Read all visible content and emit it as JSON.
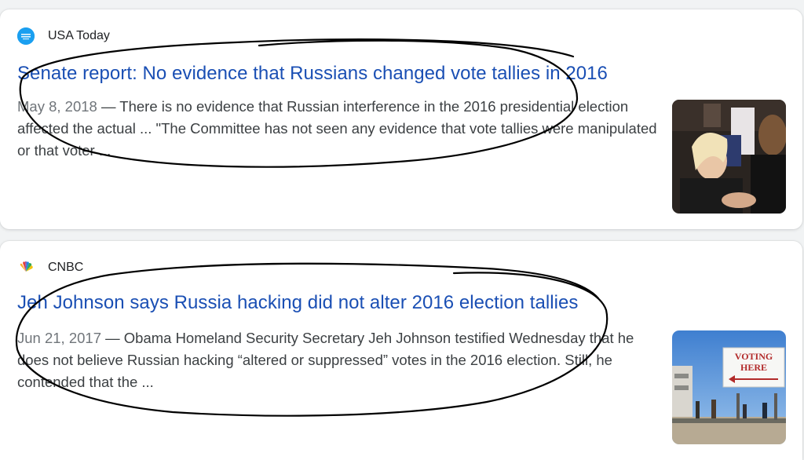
{
  "results": [
    {
      "source": "USA Today",
      "source_logo_icon": "usa-today-logo-icon",
      "headline": "Senate report: No evidence that Russians changed vote tallies in 2016",
      "date": "May 8, 2018",
      "separator": " — ",
      "snippet": "There is no evidence that Russian interference in the 2016 presidential election affected the actual ... \"The Committee has not seen any evidence that vote tallies were manipulated or that voter ...",
      "thumbnail": "photo of officials shaking hands at a hearing"
    },
    {
      "source": "CNBC",
      "source_logo_icon": "nbc-peacock-logo-icon",
      "headline": "Jeh Johnson says Russia hacking did not alter 2016 election tallies",
      "date": "Jun 21, 2017",
      "separator": " — ",
      "snippet": "Obama Homeland Security Secretary Jeh Johnson testified Wednesday that he does not believe Russian hacking “altered or suppressed” votes in the 2016 election. Still, he contended that the ...",
      "thumbnail": "photo of a voting here sign outside a polling place",
      "sign_text": [
        "VOTING",
        "HERE"
      ]
    }
  ],
  "colors": {
    "headline": "#1a4fb4",
    "snippet": "#3c4043",
    "date": "#70757a",
    "annotation_ink": "#000000"
  }
}
